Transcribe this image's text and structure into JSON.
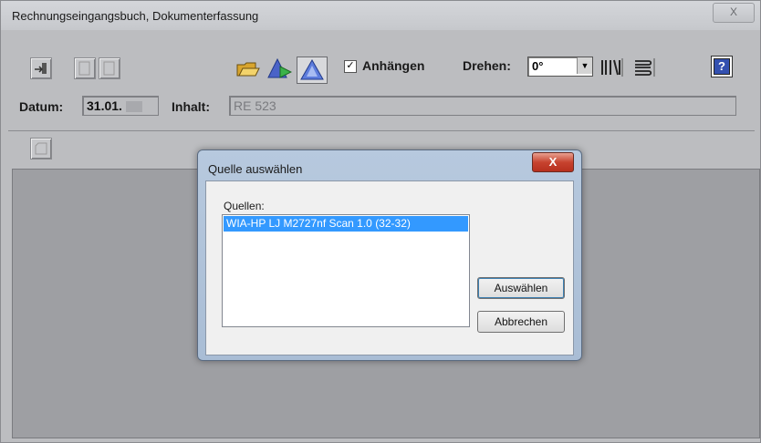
{
  "window": {
    "title": "Rechnungseingangsbuch, Dokumenterfassung",
    "close_label": "X"
  },
  "toolbar": {
    "append_label": "Anhängen",
    "append_checked": true,
    "append_check_mark": "✓",
    "rotate_label": "Drehen:",
    "rotate_value": "0°",
    "help_label": "?"
  },
  "form": {
    "date_label": "Datum:",
    "date_value": "31.01.",
    "content_label": "Inhalt:",
    "content_value": "RE 523"
  },
  "dialog": {
    "title": "Quelle auswählen",
    "close_label": "X",
    "sources_label": "Quellen:",
    "sources": [
      "WIA-HP LJ M2727nf Scan 1.0 (32-32)"
    ],
    "select_label": "Auswählen",
    "cancel_label": "Abbrechen"
  },
  "colors": {
    "selection": "#3399ff",
    "dialog_frame": "#b7c9de",
    "close_red": "#c7432f"
  }
}
